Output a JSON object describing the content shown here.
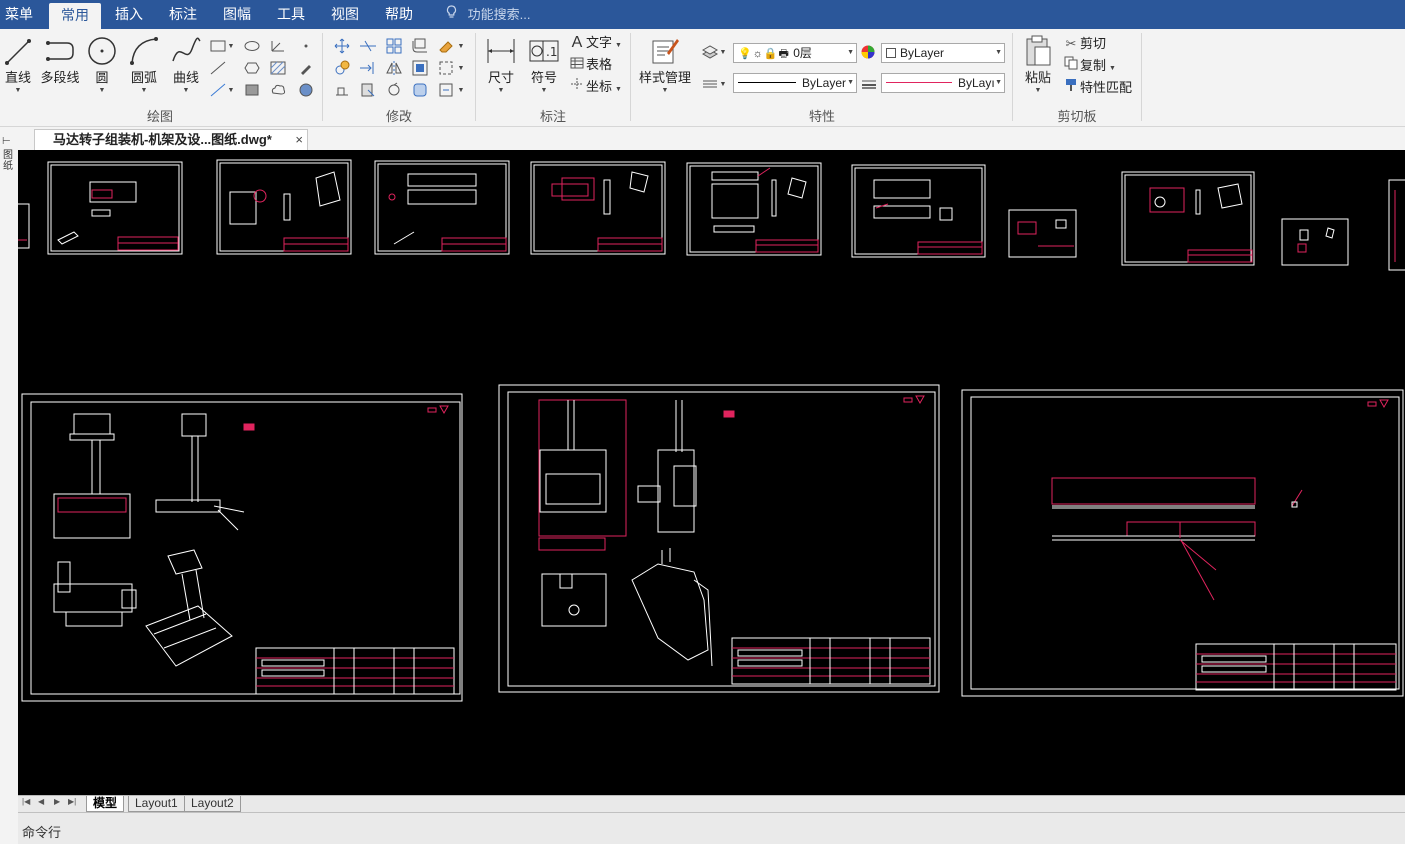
{
  "menubar": {
    "items": [
      "菜单",
      "常用",
      "插入",
      "标注",
      "图幅",
      "工具",
      "视图",
      "帮助"
    ],
    "active": "常用",
    "search_placeholder": "功能搜索..."
  },
  "ribbon": {
    "draw": {
      "label": "绘图",
      "line": "直线",
      "polyline": "多段线",
      "circle": "圆",
      "arc": "圆弧",
      "curve": "曲线"
    },
    "modify": {
      "label": "修改"
    },
    "annotate": {
      "label": "标注",
      "dimension": "尺寸",
      "symbol": "符号",
      "text": "文字",
      "table": "表格",
      "coordinate": "坐标"
    },
    "properties": {
      "label": "特性",
      "style_manager": "样式管理",
      "layer_value": "0层",
      "color_value": "ByLayer",
      "linetype_value": "ByLayer",
      "lineweight_value": "ByLayı"
    },
    "clipboard": {
      "label": "剪切板",
      "paste": "粘贴",
      "cut": "剪切",
      "copy": "复制",
      "match": "特性匹配"
    }
  },
  "document": {
    "tab_title": "马达转子组装机-机架及设...图纸.dwg*",
    "close": "×"
  },
  "left_strip": {
    "label": "图\n纸"
  },
  "layouts": {
    "tabs": [
      "模型",
      "Layout1",
      "Layout2"
    ],
    "active": "模型"
  },
  "command": {
    "label": "命令行"
  },
  "colors": {
    "menubar": "#2b579a",
    "canvas": "#000000",
    "accent_magenta": "#ff1493",
    "drawing_white": "#ffffff"
  }
}
